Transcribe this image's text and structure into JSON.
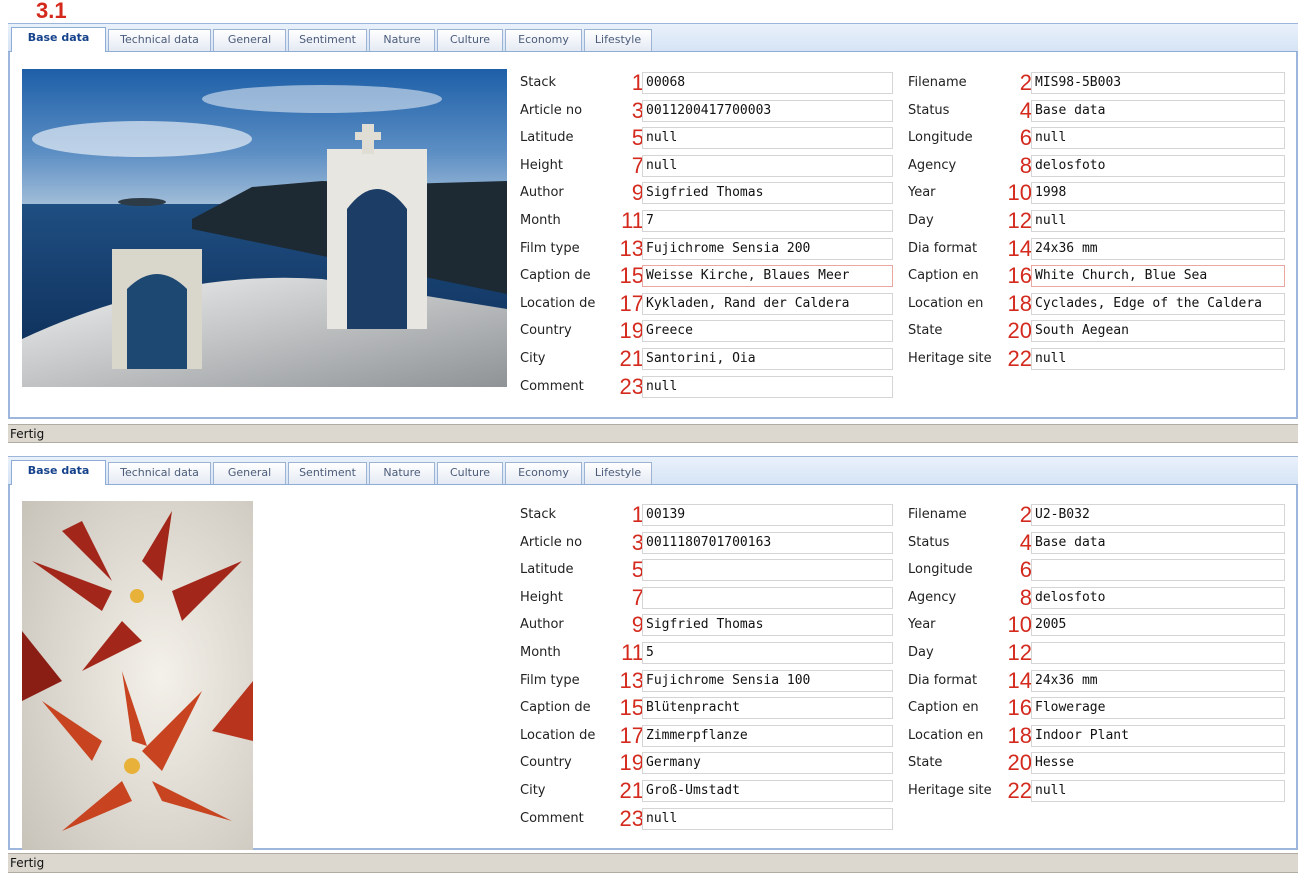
{
  "step_badge": "3.1",
  "tabs": [
    "Base data",
    "Technical data",
    "General",
    "Sentiment",
    "Nature",
    "Culture",
    "Economy",
    "Lifestyle"
  ],
  "field_labels": [
    "Stack",
    "Filename",
    "Article no",
    "Status",
    "Latitude",
    "Longitude",
    "Height",
    "Agency",
    "Author",
    "Year",
    "Month",
    "Day",
    "Film type",
    "Dia format",
    "Caption de",
    "Caption en",
    "Location de",
    "Location en",
    "Country",
    "State",
    "City",
    "Heritage site",
    "Comment"
  ],
  "field_numbers": [
    "1",
    "2",
    "3",
    "4",
    "5",
    "6",
    "7",
    "8",
    "9",
    "10",
    "11",
    "12",
    "13",
    "14",
    "15",
    "16",
    "17",
    "18",
    "19",
    "20",
    "21",
    "22",
    "23"
  ],
  "records": [
    {
      "values": [
        "00068",
        "MIS98-5B003",
        "0011200417700003",
        "Base data",
        "null",
        "null",
        "null",
        "delosfoto",
        "Sigfried Thomas",
        "1998",
        "7",
        "null",
        "Fujichrome Sensia 200",
        "24x36 mm",
        "Weisse Kirche, Blaues Meer",
        "White Church, Blue Sea",
        "Kykladen, Rand der Caldera",
        "Cyclades, Edge of the Caldera",
        "Greece",
        "South Aegean",
        "Santorini, Oia",
        "null",
        "null"
      ],
      "status_text": "Fertig"
    },
    {
      "values": [
        "00139",
        "U2-B032",
        "0011180701700163",
        "Base data",
        "",
        "",
        "",
        "delosfoto",
        "Sigfried Thomas",
        "2005",
        "5",
        "",
        "Fujichrome Sensia 100",
        "24x36 mm",
        "Blütenpracht",
        "Flowerage",
        "Zimmerpflanze",
        "Indoor Plant",
        "Germany",
        "Hesse",
        "Groß-Umstadt",
        "null",
        "null"
      ],
      "status_text": "Fertig"
    }
  ],
  "colors": {
    "annotation": "#d42a1e",
    "tab_border": "#8eadd6",
    "status_bar": "#dcd8d0"
  }
}
